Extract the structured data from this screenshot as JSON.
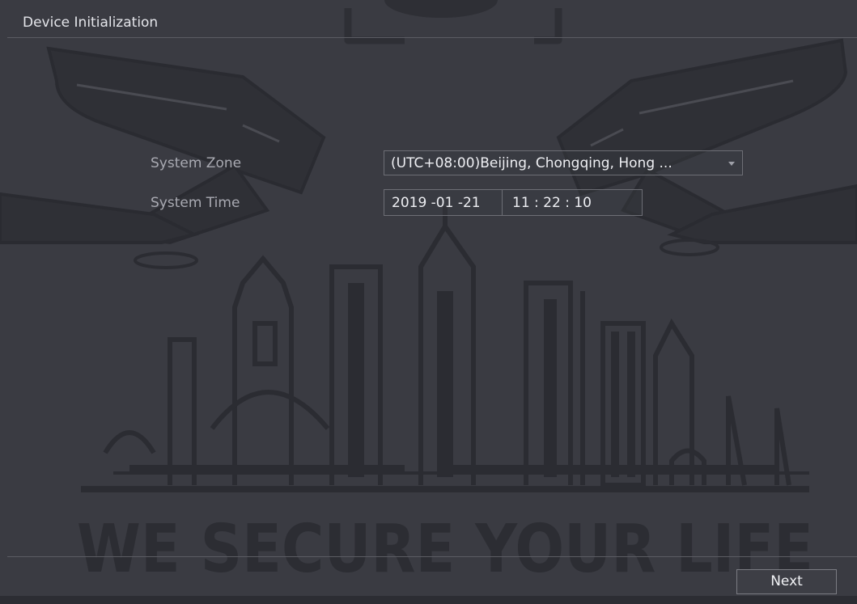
{
  "window": {
    "title": "Device Initialization"
  },
  "background": {
    "slogan": "WE SECURE YOUR LIFE"
  },
  "form": {
    "system_zone": {
      "label": "System Zone",
      "value": "(UTC+08:00)Beijing, Chongqing, Hong ..."
    },
    "system_time": {
      "label": "System Time",
      "date": "2019 -01 -21",
      "time": "11 : 22 : 10"
    }
  },
  "footer": {
    "next_label": "Next"
  },
  "colors": {
    "background": "#3a3b42",
    "line": "#5b5c63",
    "text": "#eeeff3"
  }
}
